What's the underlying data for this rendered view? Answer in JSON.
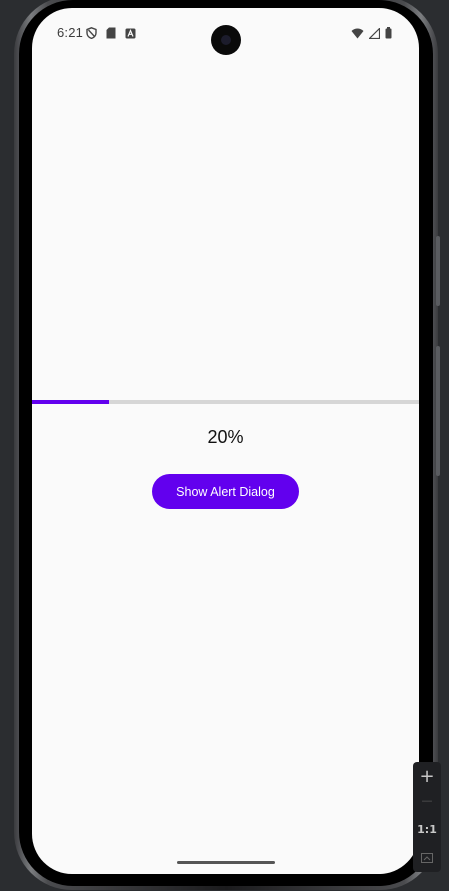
{
  "status_bar": {
    "time": "6:21",
    "left_icons": [
      "shield-icon",
      "sd-card-icon",
      "a-notification-icon"
    ],
    "right_icons": [
      "wifi-icon",
      "cellular-signal-icon",
      "battery-icon"
    ]
  },
  "progress": {
    "value_fraction": 0.2,
    "label": "20%",
    "fill_color": "#6200ee",
    "track_color": "#d6d6d6"
  },
  "alert_button": {
    "label": "Show Alert Dialog",
    "color": "#6200ee"
  },
  "zoom_toolbar": {
    "zoom_in": "+",
    "zoom_out": "—",
    "actual_size": "1:1"
  }
}
